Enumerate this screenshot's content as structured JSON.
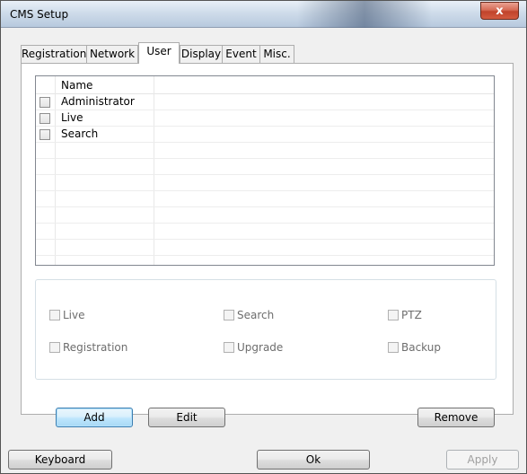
{
  "window": {
    "title": "CMS Setup",
    "close_label": "x"
  },
  "tabs": [
    {
      "label": "Registration",
      "active": false
    },
    {
      "label": "Network",
      "active": false
    },
    {
      "label": "User",
      "active": true
    },
    {
      "label": "Display",
      "active": false
    },
    {
      "label": "Event",
      "active": false
    },
    {
      "label": "Misc.",
      "active": false
    }
  ],
  "user_list": {
    "column_header": "Name",
    "users": [
      {
        "name": "Administrator",
        "checked": false
      },
      {
        "name": "Live",
        "checked": false
      },
      {
        "name": "Search",
        "checked": false
      }
    ]
  },
  "permissions": [
    {
      "label": "Live",
      "checked": false,
      "enabled": false
    },
    {
      "label": "Search",
      "checked": false,
      "enabled": false
    },
    {
      "label": "PTZ",
      "checked": false,
      "enabled": false
    },
    {
      "label": "Registration",
      "checked": false,
      "enabled": false
    },
    {
      "label": "Upgrade",
      "checked": false,
      "enabled": false
    },
    {
      "label": "Backup",
      "checked": false,
      "enabled": false
    }
  ],
  "buttons": {
    "add": "Add",
    "edit": "Edit",
    "remove": "Remove",
    "keyboard": "Keyboard",
    "ok": "Ok",
    "apply": "Apply"
  },
  "colors": {
    "accent": "#3c7fb1",
    "disabled_text": "#6d6d6d",
    "close_button": "#c0432b"
  }
}
